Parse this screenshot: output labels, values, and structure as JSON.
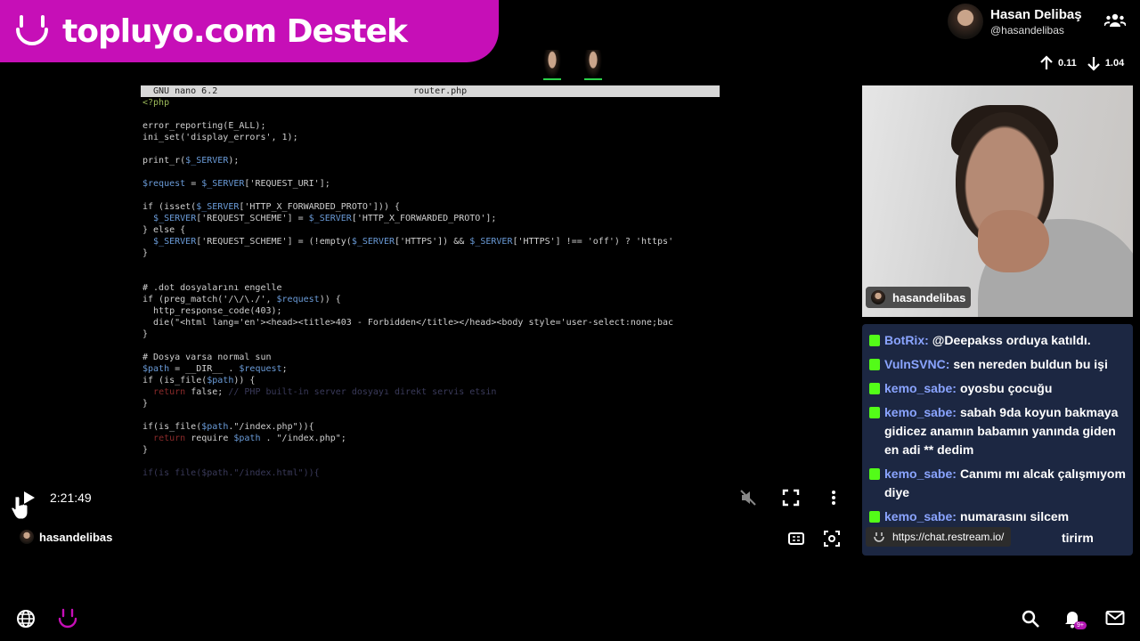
{
  "banner": {
    "text": "topluyo.com Destek",
    "color": "#c60fb7"
  },
  "profile": {
    "display_name": "Hasan Delibaş",
    "handle": "@hasandelibas"
  },
  "stats": {
    "upload": "0.11",
    "download": "1.04"
  },
  "terminal": {
    "app": "GNU nano 6.2",
    "filename": "router.php"
  },
  "player": {
    "time": "2:21:49",
    "owner": "hasandelibas",
    "icons": [
      "play-icon",
      "mute-icon",
      "fullscreen-icon",
      "more-icon",
      "theater-icon",
      "screenshot-icon"
    ]
  },
  "webcam": {
    "label": "hasandelibas"
  },
  "chat": {
    "messages": [
      {
        "user": "BotRix:",
        "text": "@Deepakss orduya katıldı."
      },
      {
        "user": "VulnSVNC:",
        "text": "sen nereden buldun bu işi"
      },
      {
        "user": "kemo_sabe:",
        "text": "oyosbu çocuğu"
      },
      {
        "user": "kemo_sabe:",
        "text": "sabah 9da koyun bakmaya gidicez anamın babamın yanında giden en adi ** dedim"
      },
      {
        "user": "kemo_sabe:",
        "text": "Canımı mı alcak çalışmıyom diye"
      },
      {
        "user": "kemo_sabe:",
        "text": "numarasını silcem"
      }
    ],
    "tooltip_url": "https://chat.restream.io/",
    "tail_text": "tirirm"
  },
  "bottom_nav": {
    "notification_badge": "9+"
  },
  "accent_colors": {
    "kick_green": "#53fc18",
    "chat_bg": "#1c2742",
    "username": "#8aa4ff"
  }
}
